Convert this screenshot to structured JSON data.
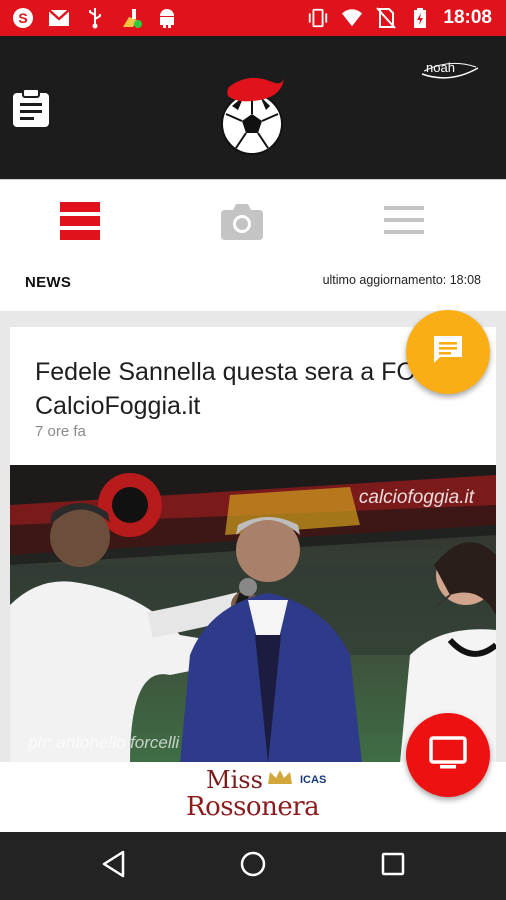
{
  "status_bar": {
    "time": "18:08",
    "left_icons": [
      "skype-icon",
      "gmail-icon",
      "usb-icon",
      "cleaner-icon",
      "android-icon"
    ],
    "right_icons": [
      "vibrate-icon",
      "wifi-icon",
      "no-sim-icon",
      "battery-charging-icon"
    ],
    "color": "#e0121b"
  },
  "header": {
    "background": "#1c1c1c",
    "sponsor_logo": "noah"
  },
  "tabs": [
    {
      "name": "news",
      "icon": "news-list-icon",
      "active": true
    },
    {
      "name": "photo",
      "icon": "camera-icon",
      "active": false
    },
    {
      "name": "menu",
      "icon": "menu-icon",
      "active": false
    }
  ],
  "section": {
    "title": "NEWS",
    "updated": "ultimo aggiornamento: 18:08"
  },
  "article": {
    "headline": "Fedele Sannella questa sera a FO´ - CalcioFoggia.it",
    "time_ago": "7 ore fa",
    "watermark": "calciofoggia.it",
    "credit": "ph: antonello forcelli"
  },
  "banner": {
    "line1": "Miss",
    "line2": "Rossonera",
    "sponsor": "ICAS"
  },
  "accent_color": "#e0121b",
  "chat_fab_color": "#f9ae16"
}
